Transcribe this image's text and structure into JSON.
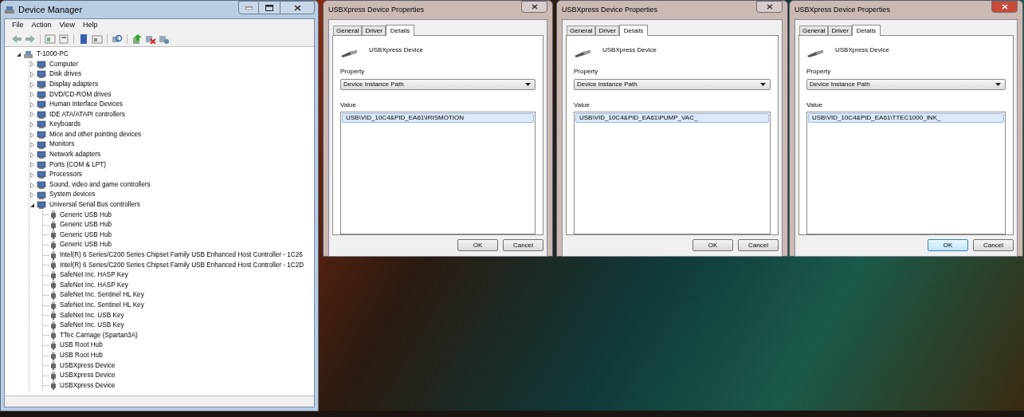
{
  "device_manager": {
    "title": "Device Manager",
    "menu": [
      "File",
      "Action",
      "View",
      "Help"
    ],
    "tree": {
      "label": "T-1000-PC",
      "expanded": true,
      "children": [
        {
          "label": "Computer",
          "expanded": false
        },
        {
          "label": "Disk drives",
          "expanded": false
        },
        {
          "label": "Display adapters",
          "expanded": false
        },
        {
          "label": "DVD/CD-ROM drives",
          "expanded": false
        },
        {
          "label": "Human Interface Devices",
          "expanded": false
        },
        {
          "label": "IDE ATA/ATAPI controllers",
          "expanded": false
        },
        {
          "label": "Keyboards",
          "expanded": false
        },
        {
          "label": "Mice and other pointing devices",
          "expanded": false
        },
        {
          "label": "Monitors",
          "expanded": false
        },
        {
          "label": "Network adapters",
          "expanded": false
        },
        {
          "label": "Ports (COM & LPT)",
          "expanded": false
        },
        {
          "label": "Processors",
          "expanded": false
        },
        {
          "label": "Sound, video and game controllers",
          "expanded": false
        },
        {
          "label": "System devices",
          "expanded": false
        },
        {
          "label": "Universal Serial Bus controllers",
          "expanded": true,
          "children": [
            {
              "label": "Generic USB Hub"
            },
            {
              "label": "Generic USB Hub"
            },
            {
              "label": "Generic USB Hub"
            },
            {
              "label": "Generic USB Hub"
            },
            {
              "label": "Intel(R) 6 Series/C200 Series Chipset Family USB Enhanced Host Controller - 1C26"
            },
            {
              "label": "Intel(R) 6 Series/C200 Series Chipset Family USB Enhanced Host Controller - 1C2D"
            },
            {
              "label": "SafeNet Inc. HASP Key"
            },
            {
              "label": "SafeNet Inc. HASP Key"
            },
            {
              "label": "SafeNet Inc. Sentinel HL Key"
            },
            {
              "label": "SafeNet Inc. Sentinel HL Key"
            },
            {
              "label": "SafeNet Inc. USB Key"
            },
            {
              "label": "SafeNet Inc. USB Key"
            },
            {
              "label": "TTec Carriage (Spartan3A)"
            },
            {
              "label": "USB Root Hub"
            },
            {
              "label": "USB Root Hub"
            },
            {
              "label": "USBXpress Device"
            },
            {
              "label": "USBXpress Device"
            },
            {
              "label": "USBXpress Device"
            }
          ]
        }
      ]
    }
  },
  "dialogs": [
    {
      "title": "USBXpress Device Properties",
      "tabs": [
        {
          "label": "General",
          "selected": false
        },
        {
          "label": "Driver",
          "selected": false
        },
        {
          "label": "Details",
          "selected": true
        }
      ],
      "device_name": "USBXpress Device",
      "property_label": "Property",
      "property_value": "Device Instance Path",
      "value_label": "Value",
      "values": [
        {
          "text": "USB\\VID_10C4&PID_EA61\\IRISMOTION",
          "selected": true
        }
      ],
      "buttons": [
        {
          "label": "OK",
          "focused": false
        },
        {
          "label": "Cancel",
          "focused": false
        }
      ]
    },
    {
      "title": "USBXpress Device Properties",
      "tabs": [
        {
          "label": "General",
          "selected": false
        },
        {
          "label": "Driver",
          "selected": false
        },
        {
          "label": "Details",
          "selected": true
        }
      ],
      "device_name": "USBXpress Device",
      "property_label": "Property",
      "property_value": "Device Instance Path",
      "value_label": "Value",
      "values": [
        {
          "text": "USB\\VID_10C4&PID_EA61\\PUMP_VAC_",
          "selected": true
        }
      ],
      "buttons": [
        {
          "label": "OK",
          "focused": false
        },
        {
          "label": "Cancel",
          "focused": false
        }
      ]
    },
    {
      "title": "USBXpress Device Properties",
      "tabs": [
        {
          "label": "General",
          "selected": false
        },
        {
          "label": "Driver",
          "selected": false
        },
        {
          "label": "Details",
          "selected": true
        }
      ],
      "device_name": "USBXpress Device",
      "property_label": "Property",
      "property_value": "Device Instance Path",
      "value_label": "Value",
      "values": [
        {
          "text": "USB\\VID_10C4&PID_EA61\\TTEC1000_INK_",
          "selected": true
        }
      ],
      "buttons": [
        {
          "label": "OK",
          "focused": true
        },
        {
          "label": "Cancel",
          "focused": false
        }
      ]
    }
  ]
}
